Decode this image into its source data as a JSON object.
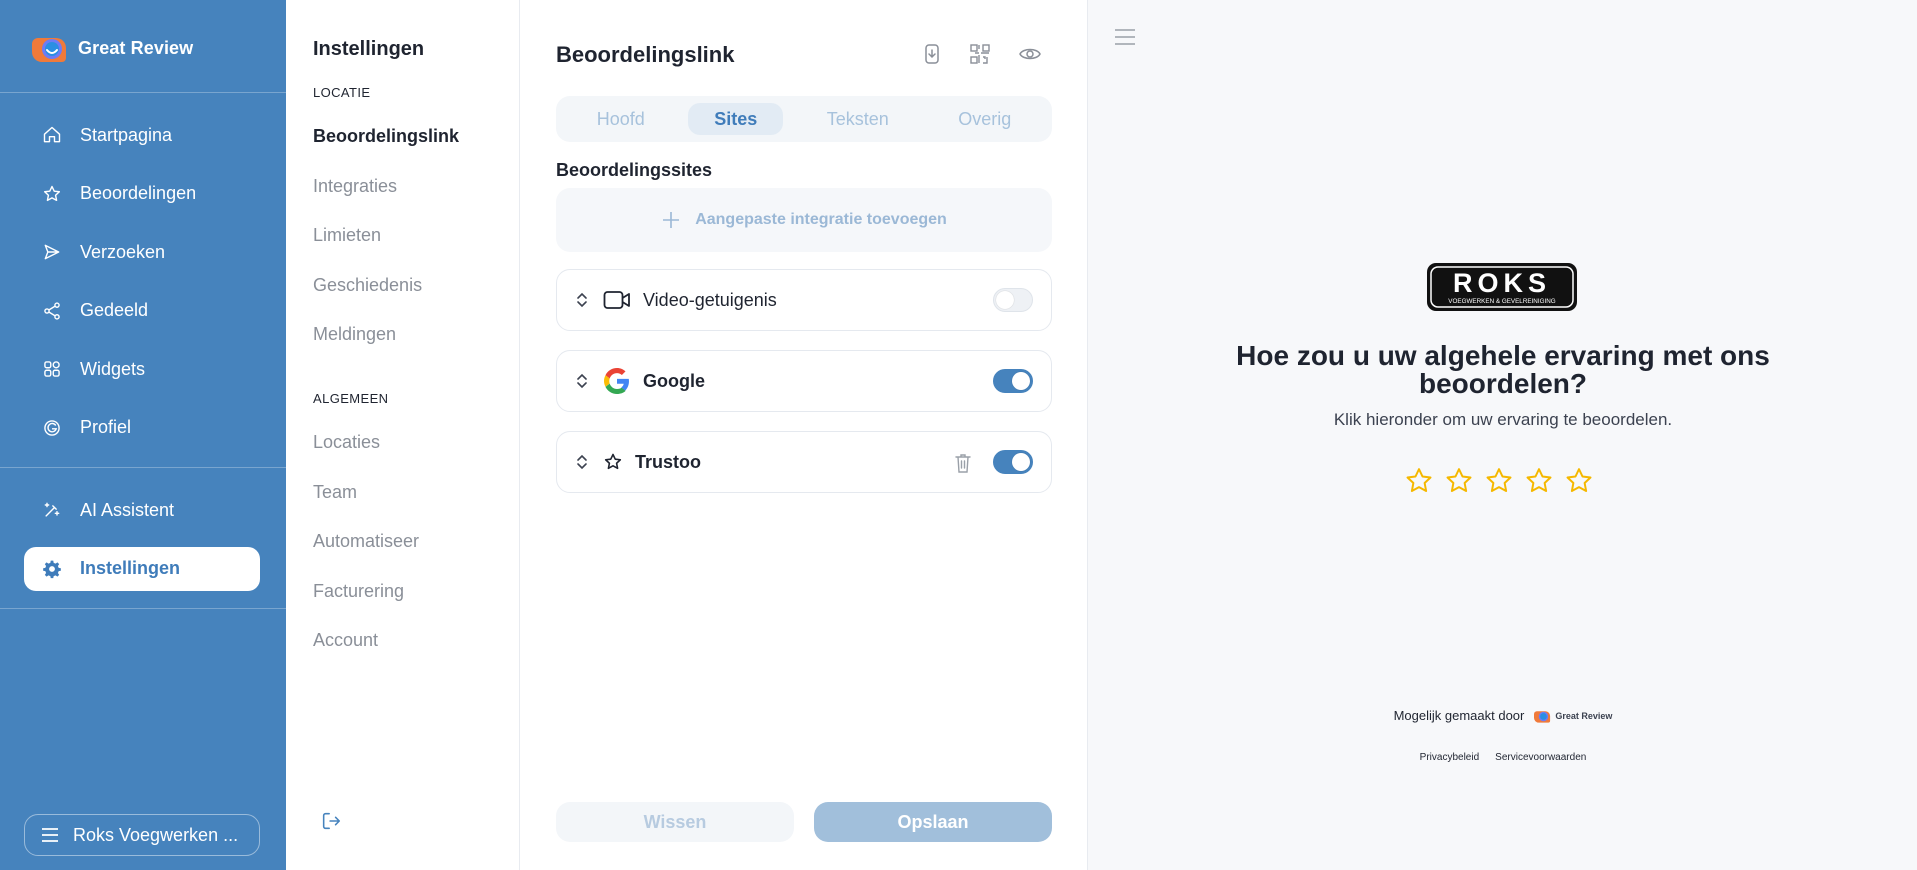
{
  "brand": {
    "name": "Great Review"
  },
  "sidebar": {
    "items": [
      {
        "label": "Startpagina",
        "icon": "home-icon"
      },
      {
        "label": "Beoordelingen",
        "icon": "star-icon"
      },
      {
        "label": "Verzoeken",
        "icon": "send-icon"
      },
      {
        "label": "Gedeeld",
        "icon": "share-icon"
      },
      {
        "label": "Widgets",
        "icon": "widgets-icon"
      },
      {
        "label": "Profiel",
        "icon": "profile-icon"
      }
    ],
    "secondary": [
      {
        "label": "AI Assistent",
        "icon": "magic-wand-icon"
      },
      {
        "label": "Instellingen",
        "icon": "gear-icon",
        "active": true
      }
    ],
    "location_switcher": "Roks Voegwerken ..."
  },
  "settings": {
    "title": "Instellingen",
    "section_location": "LOCATIE",
    "location_items": [
      "Beoordelingslink",
      "Integraties",
      "Limieten",
      "Geschiedenis",
      "Meldingen"
    ],
    "section_general": "ALGEMEEN",
    "general_items": [
      "Locaties",
      "Team",
      "Automatiseer",
      "Facturering",
      "Account"
    ]
  },
  "main": {
    "title": "Beoordelingslink",
    "tabs": [
      "Hoofd",
      "Sites",
      "Teksten",
      "Overig"
    ],
    "active_tab": "Sites",
    "section_title": "Beoordelingssites",
    "add_integration": "Aangepaste integratie toevoegen",
    "sites": [
      {
        "name": "Video-getuigenis",
        "enabled": false
      },
      {
        "name": "Google",
        "enabled": true
      },
      {
        "name": "Trustoo",
        "enabled": true
      }
    ],
    "clear_label": "Wissen",
    "save_label": "Opslaan"
  },
  "preview": {
    "logo_text": "ROKS",
    "logo_subtext": "VOEGWERKEN & GEVELREINIGING",
    "question": "Hoe zou u uw algehele ervaring met ons beoordelen?",
    "subtitle": "Klik hieronder om uw ervaring te beoordelen.",
    "star_count": 5,
    "powered_by": "Mogelijk gemaakt door",
    "powered_brand": "Great Review",
    "privacy": "Privacybeleid",
    "terms": "Servicevoorwaarden"
  },
  "colors": {
    "sidebar_bg": "#4683bd",
    "accent": "#3f7cba",
    "star": "#f5b800"
  }
}
